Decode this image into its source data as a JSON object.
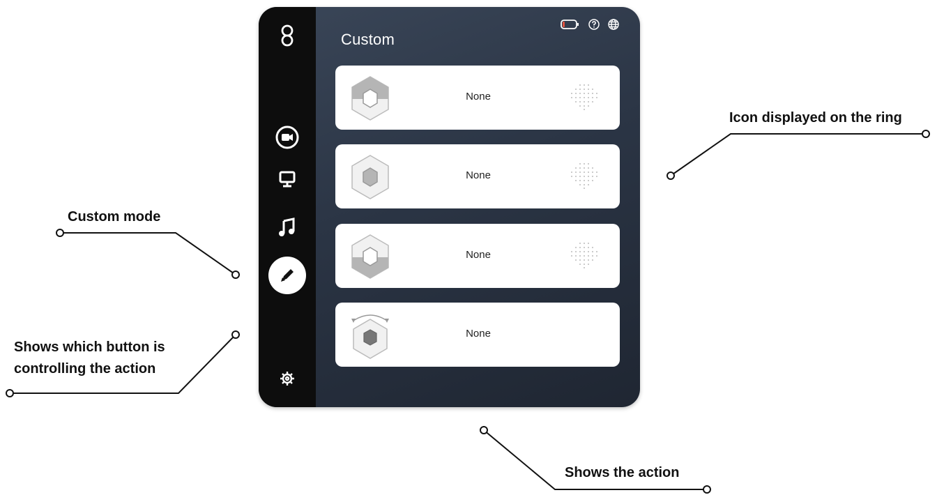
{
  "app": {
    "title": "Custom"
  },
  "sidebar": {
    "items": [
      {
        "icon": "logo-icon"
      },
      {
        "icon": "video-camera-icon"
      },
      {
        "icon": "monitor-icon"
      },
      {
        "icon": "music-note-icon"
      },
      {
        "icon": "pencil-icon",
        "active": true
      },
      {
        "icon": "gear-icon"
      }
    ]
  },
  "topbar": {
    "icons": [
      "battery-icon",
      "help-icon",
      "globe-icon"
    ],
    "battery_color": "#e0523f"
  },
  "actions": [
    {
      "label": "None",
      "button": "top-hex",
      "ring_icon": "dot-grid-icon"
    },
    {
      "label": "None",
      "button": "center-hex",
      "ring_icon": "dot-grid-icon"
    },
    {
      "label": "None",
      "button": "bottom-hex",
      "ring_icon": "dot-grid-icon"
    },
    {
      "label": "None",
      "button": "rotate-hex",
      "ring_icon": null
    }
  ],
  "callouts": {
    "icon_ring": "Icon displayed on the ring",
    "custom_mode": "Custom mode",
    "button_control_line1": "Shows which button is",
    "button_control_line2": "controlling the action",
    "shows_action": "Shows the action"
  },
  "colors": {
    "panel_bg": "#2b3545",
    "sidebar_bg": "#0d0d0d",
    "card_bg": "#ffffff"
  }
}
